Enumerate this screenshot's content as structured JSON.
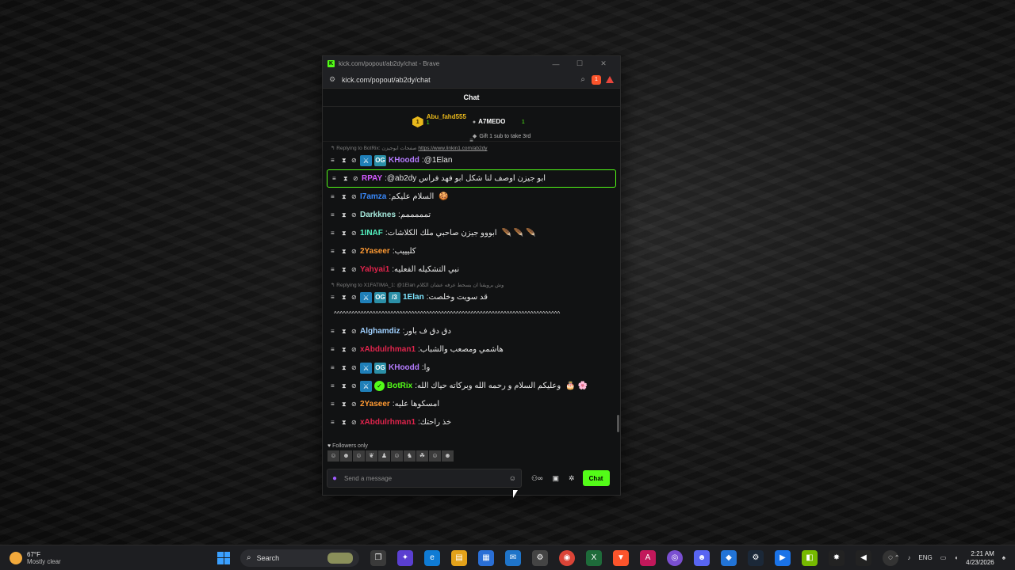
{
  "window": {
    "title": "kick.com/popout/ab2dy/chat - Brave",
    "url": "kick.com/popout/ab2dy/chat",
    "brave_count": "1"
  },
  "chat": {
    "header": "Chat",
    "leaderboard": {
      "first_name": "Abu_fahd555",
      "first_rank": "1",
      "first_count": "1",
      "second_name": "A7MEDO",
      "second_count": "1",
      "gift_note": "Gift 1 sub to take 3rd"
    },
    "reply1": {
      "prefix": "Replying to BotRix:",
      "text": "صفحات ابوجيزن",
      "link": "https://www.linkin1.com/ab2dy"
    },
    "messages": [
      {
        "user": "KHoodd",
        "color": "#b57cff",
        "sep": ": ",
        "text": "@1Elan",
        "badges": [
          "sword",
          "og"
        ]
      },
      {
        "user": "RPAY",
        "color": "#d35bff",
        "sep": ": ",
        "text": "@ab2dy ابو جيزن اوصف لنا شكل ابو فهد فراس",
        "badges": []
      },
      {
        "user": "I7amza",
        "color": "#3a8bff",
        "sep": ": ",
        "text": "السلام عليكم",
        "emote": "🍪",
        "badges": []
      },
      {
        "user": "Darkknes",
        "color": "#a6e9dc",
        "sep": ": ",
        "text": "تمممممم",
        "badges": []
      },
      {
        "user": "1INAF",
        "color": "#54f3c2",
        "sep": ": ",
        "text": "ابووو جيزن صاحبي ملك الكلاشات",
        "emote": "🪶 🪶 🪶",
        "badges": []
      },
      {
        "user": "2Yaseer",
        "color": "#ff9a33",
        "sep": ": ",
        "text": "كليييب",
        "badges": []
      },
      {
        "user": "Yahyai1",
        "color": "#e0244c",
        "sep": ": ",
        "text": "نبي التشكيله الفعليه",
        "badges": []
      }
    ],
    "reply2": {
      "prefix": "Replying to X1FATIMA_1:",
      "text": "@1Elan وش برويقنا ان بسحط عرفه عشان الكلام"
    },
    "elan_message": {
      "user": "1Elan",
      "color": "#7fe6ff",
      "sep": ": ",
      "text": "قد سويت وخلصت"
    },
    "long_text": "^^^^^^^^^^^^^^^^^^^^^^^^^^^^^^^^^^^^^^^^^^^^^^^^^^^^^^^^^^^^^^^^^^^^^^^^^^^^",
    "messages2": [
      {
        "user": "Alghamdiz",
        "color": "#9fd0ff",
        "sep": ": ",
        "text": "دق دق ف باور",
        "badges": []
      },
      {
        "user": "xAbdulrhman1",
        "color": "#e0244c",
        "sep": ": ",
        "text": "هاشمي ومصعب والشباب",
        "badges": []
      },
      {
        "user": "KHoodd",
        "color": "#b57cff",
        "sep": ": ",
        "text": "وا",
        "badges": [
          "sword",
          "og"
        ]
      },
      {
        "user": "BotRix",
        "color": "#53fc18",
        "sep": ": ",
        "text": "وعليكم السلام و رحمه الله وبركاته حياك الله",
        "emote": "🎂 🌸",
        "badges": [
          "sword",
          "verified"
        ]
      },
      {
        "user": "2Yaseer",
        "color": "#ff9a33",
        "sep": ": ",
        "text": "امسكوها عليه",
        "badges": []
      },
      {
        "user": "xAbdulrhman1",
        "color": "#e0244c",
        "sep": ": ",
        "text": "خذ راحتك",
        "badges": []
      }
    ],
    "followers_label": "Followers only",
    "input_placeholder": "Send a message",
    "send_label": "Chat",
    "colors": {
      "accent": "#53fc18"
    }
  },
  "taskbar": {
    "temp": "67°F",
    "condition": "Mostly clear",
    "search_label": "Search",
    "lang": "ENG",
    "time": "2:21 AM",
    "date": "4/23/2026"
  }
}
